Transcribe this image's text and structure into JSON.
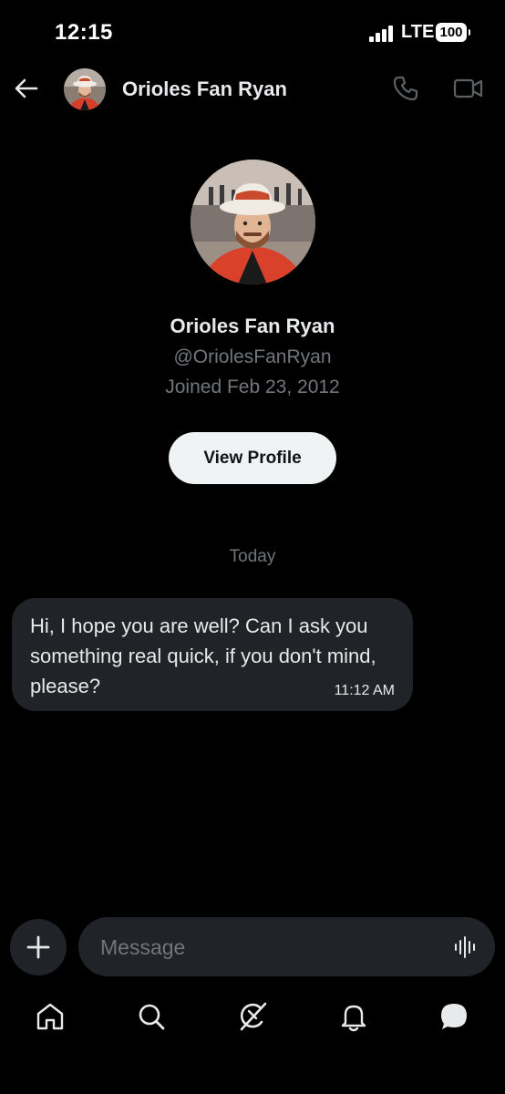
{
  "status_bar": {
    "time": "12:15",
    "network": "LTE",
    "battery": "100"
  },
  "header": {
    "contact_name": "Orioles Fan Ryan",
    "avatar_icon": "profile-photo",
    "back_icon": "arrow-left-icon",
    "call_icon": "phone-icon",
    "video_icon": "video-camera-icon"
  },
  "profile": {
    "name": "Orioles Fan Ryan",
    "handle": "@OriolesFanRyan",
    "joined": "Joined Feb 23, 2012",
    "view_profile_label": "View Profile"
  },
  "conversation": {
    "date_divider": "Today",
    "messages": [
      {
        "text": "Hi, I hope you are well? Can I ask you something real quick, if you don't mind, please?",
        "time": "11:12 AM",
        "direction": "incoming"
      }
    ]
  },
  "composer": {
    "placeholder": "Message",
    "add_icon": "plus-icon",
    "voice_icon": "voice-waveform-icon"
  },
  "bottom_nav": {
    "items": [
      {
        "name": "home",
        "icon": "home-icon"
      },
      {
        "name": "search",
        "icon": "search-icon"
      },
      {
        "name": "grok",
        "icon": "grok-icon"
      },
      {
        "name": "notifications",
        "icon": "bell-icon"
      },
      {
        "name": "messages",
        "icon": "message-icon",
        "active": true
      }
    ]
  },
  "colors": {
    "background": "#000000",
    "bubble": "#202327",
    "text_primary": "#e7e9ea",
    "text_secondary": "#71767b",
    "button_bg": "#eff3f4"
  }
}
